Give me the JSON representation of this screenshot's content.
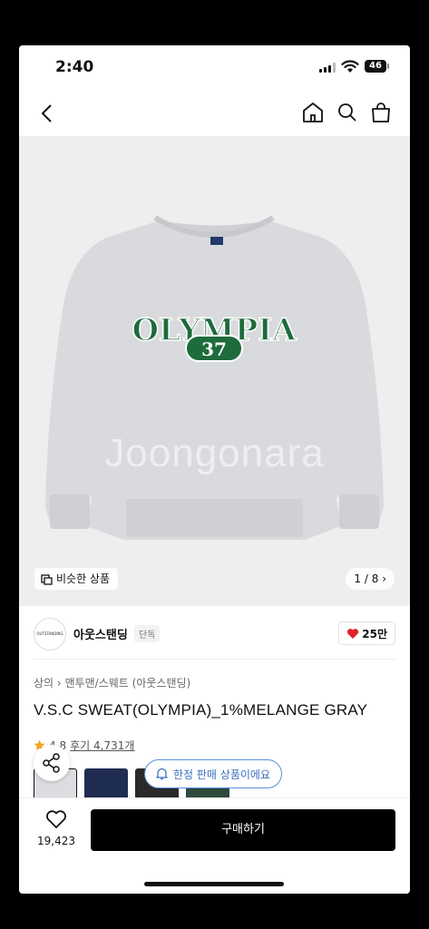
{
  "status": {
    "time": "2:40",
    "battery": "46"
  },
  "nav": {
    "back": "back-icon",
    "home": "home-icon",
    "search": "search-icon",
    "bag": "bag-icon"
  },
  "hero": {
    "print_word": "OLYMPIA",
    "print_number": "37",
    "watermark": "Joongonara",
    "similar_label": "비슷한 상품",
    "counter": "1 / 8"
  },
  "brand": {
    "logo_text": "OUTSTANDING",
    "name": "아웃스탠딩",
    "tag": "단독",
    "likes": "25만"
  },
  "product": {
    "breadcrumb_1": "상의",
    "breadcrumb_2": "맨투맨/스웨트 (아웃스탠딩)",
    "title": "V.S.C SWEAT(OLYMPIA)_1%MELANGE GRAY",
    "rating": "4.8",
    "reviews": "후기 4,731개"
  },
  "thumbnails": [
    "gray",
    "navy",
    "black",
    "green"
  ],
  "toast": {
    "label": "한정 판매 상품이에요"
  },
  "bottom": {
    "wish_count": "19,423",
    "buy_label": "구매하기"
  },
  "colors": {
    "accent_green": "#1e6b3c",
    "heart_red": "#e0222b",
    "toast_blue": "#3a6fc0"
  }
}
